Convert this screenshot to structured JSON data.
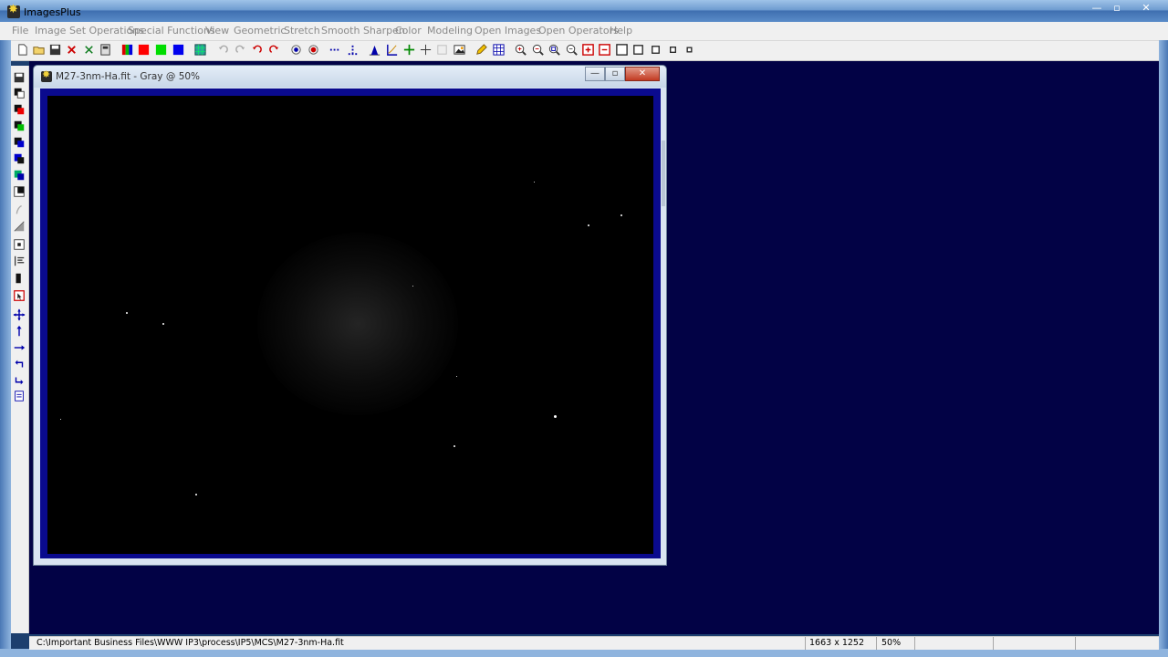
{
  "window": {
    "title": "ImagesPlus",
    "minimize_glyph": "—",
    "maximize_glyph": "▫",
    "close_glyph": "✕"
  },
  "menu": [
    "File",
    "Image Set Operations",
    "Special Functions",
    "View",
    "Geometric",
    "Stretch",
    "Smooth Sharpen",
    "Color",
    "Modeling",
    "Open Images",
    "Open Operators",
    "Help"
  ],
  "toolbar_icons": [
    "new-icon",
    "open-icon",
    "save-icon",
    "delete-icon",
    "close-x-icon",
    "calculator-icon",
    "rgb-channels-icon",
    "red-channel-icon",
    "green-channel-icon",
    "blue-channel-icon",
    "grid-icon",
    "undo-icon",
    "redo-icon",
    "undo-red-icon",
    "redo-red-icon",
    "circle-select-icon",
    "circle-fill-icon",
    "dotted-line-icon",
    "dotted-corner-icon",
    "histogram-icon",
    "curve-icon",
    "crosshair-icon",
    "crosshair-thin-icon",
    "blank-icon",
    "image-icon",
    "pencil-icon",
    "table-icon",
    "zoom-in-icon",
    "zoom-out-icon",
    "zoom-fit-icon",
    "zoom-reset-icon",
    "plus-box-icon",
    "minus-box-icon",
    "square-large-icon",
    "square-medium-icon",
    "square-small-icon",
    "square-tiny-icon",
    "square-mini-icon"
  ],
  "left_toolbar_icons": [
    "save-small-icon",
    "mask-black-icon",
    "mask-red-icon",
    "mask-green-icon",
    "mask-blue-icon",
    "mask-mixed-icon",
    "mask-teal-icon",
    "layer-icon",
    "brush-disabled-icon",
    "gradient-icon",
    "target-icon",
    "align-icon",
    "black-bar-icon",
    "select-red-icon",
    "move-icon",
    "arrow-up-icon",
    "arrow-right-icon",
    "rotate-left-icon",
    "rotate-right-icon",
    "document-icon"
  ],
  "image_window": {
    "title": "M27-3nm-Ha.fit - Gray @ 50%",
    "min_glyph": "—",
    "max_glyph": "▫",
    "close_glyph": "✕"
  },
  "status": {
    "path": "C:\\Important Business Files\\WWW IP3\\process\\IP5\\MCS\\M27-3nm-Ha.fit",
    "dimensions": "1663 x 1252",
    "zoom": "50%"
  },
  "colors": {
    "workspace": "#020245",
    "image_border": "#0a0a8e",
    "menu_text_disabled": "#8a8a8a"
  }
}
